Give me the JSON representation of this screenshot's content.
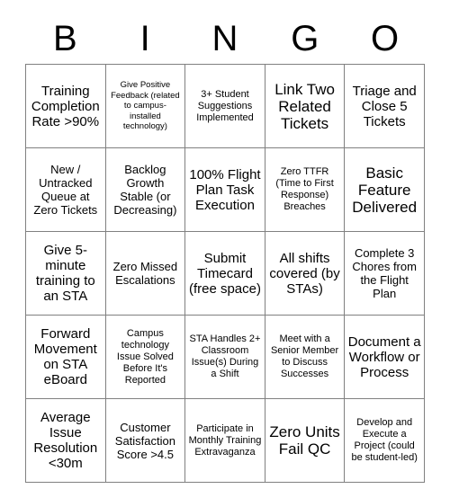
{
  "card": {
    "header_letters": [
      "B",
      "I",
      "N",
      "G",
      "O"
    ],
    "grid_border_color": "#808080",
    "text_color": "#000000",
    "background_color": "#ffffff",
    "rows": [
      [
        {
          "text": "Training Completion Rate >90%",
          "size": "t-lg"
        },
        {
          "text": "Give Positive Feedback (related to campus-installed technology)",
          "size": "t-xs"
        },
        {
          "text": "3+ Student Suggestions Implemented",
          "size": "t-sm"
        },
        {
          "text": "Link Two Related Tickets",
          "size": "t-xl"
        },
        {
          "text": "Triage and Close 5 Tickets",
          "size": "t-lg"
        }
      ],
      [
        {
          "text": "New / Untracked Queue at Zero Tickets",
          "size": "t-md"
        },
        {
          "text": "Backlog Growth Stable (or Decreasing)",
          "size": "t-md"
        },
        {
          "text": "100% Flight Plan Task Execution",
          "size": "t-lg"
        },
        {
          "text": "Zero TTFR (Time to First Response) Breaches",
          "size": "t-sm"
        },
        {
          "text": "Basic Feature Delivered",
          "size": "t-xl"
        }
      ],
      [
        {
          "text": "Give 5-minute training to an STA",
          "size": "t-lg"
        },
        {
          "text": "Zero Missed Escalations",
          "size": "t-md"
        },
        {
          "text": "Submit Timecard (free space)",
          "size": "t-lg"
        },
        {
          "text": "All shifts covered (by STAs)",
          "size": "t-lg"
        },
        {
          "text": "Complete 3 Chores from the Flight Plan",
          "size": "t-md"
        }
      ],
      [
        {
          "text": "Forward Movement on STA eBoard",
          "size": "t-lg"
        },
        {
          "text": "Campus technology Issue Solved Before It's Reported",
          "size": "t-sm"
        },
        {
          "text": "STA Handles 2+ Classroom Issue(s) During a Shift",
          "size": "t-sm"
        },
        {
          "text": "Meet with a Senior Member to Discuss Successes",
          "size": "t-sm"
        },
        {
          "text": "Document a Workflow or Process",
          "size": "t-lg"
        }
      ],
      [
        {
          "text": "Average Issue Resolution <30m",
          "size": "t-lg"
        },
        {
          "text": "Customer Satisfaction Score >4.5",
          "size": "t-md"
        },
        {
          "text": "Participate in Monthly Training Extravaganza",
          "size": "t-sm"
        },
        {
          "text": "Zero Units Fail QC",
          "size": "t-xl"
        },
        {
          "text": "Develop and Execute a Project (could be student-led)",
          "size": "t-sm"
        }
      ]
    ]
  }
}
